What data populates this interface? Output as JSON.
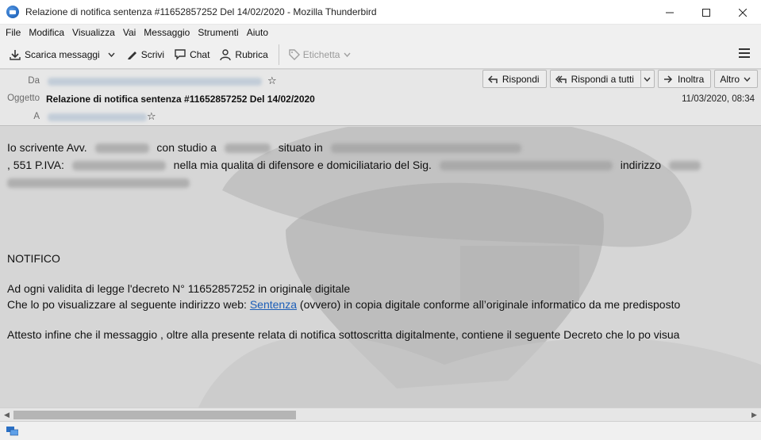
{
  "window": {
    "title": "Relazione di notifica sentenza #11652857252 Del 14/02/2020 - Mozilla Thunderbird",
    "controls": {
      "minimize": "—",
      "maximize": "☐",
      "close": "✕"
    }
  },
  "menubar": {
    "items": [
      {
        "label": "File",
        "access": "F"
      },
      {
        "label": "Modifica",
        "access": "M"
      },
      {
        "label": "Visualizza",
        "access": "V"
      },
      {
        "label": "Vai",
        "access": "a"
      },
      {
        "label": "Messaggio",
        "access": "g"
      },
      {
        "label": "Strumenti",
        "access": "S"
      },
      {
        "label": "Aiuto",
        "access": "u"
      }
    ]
  },
  "toolbar": {
    "get_messages": "Scarica messaggi",
    "write": "Scrivi",
    "chat": "Chat",
    "address_book": "Rubrica",
    "tag": "Etichetta"
  },
  "header": {
    "from_label": "Da",
    "subject_label": "Oggetto",
    "to_label": "A",
    "subject": "Relazione di notifica sentenza #11652857252 Del 14/02/2020",
    "date": "11/03/2020, 08:34",
    "actions": {
      "reply": "Rispondi",
      "reply_all": "Rispondi a tutti",
      "forward": "Inoltra",
      "more": "Altro"
    }
  },
  "body": {
    "line1_a": "Io scrivente Avv.",
    "line1_b": "con studio a",
    "line1_c": "situato in",
    "line2_a": ", 551 P.IVA:",
    "line2_b": "nella mia qualita di difensore e domiciliatario del Sig.",
    "line2_c": "indirizzo",
    "notifico": "NOTIFICO",
    "para1": "Ad  ogni  validita di  legge l'decreto N° 11652857252 in originale digitale",
    "para2_a": "Che  lo po visualizzare al seguente indirizzo web: ",
    "para2_link": "Sentenza",
    "para2_b": " (ovvero) in copia digitale conforme all’originale informatico  da me predisposto",
    "para3": "Attesto infine che il messaggio , oltre alla presente relata di notifica sottoscritta digitalmente, contiene il seguente Decreto   che lo po visua"
  },
  "colors": {
    "link": "#1c5eb8",
    "titlebar": "#ffffff",
    "toolbar": "#f0f0f0",
    "header": "#e7e7e7"
  }
}
